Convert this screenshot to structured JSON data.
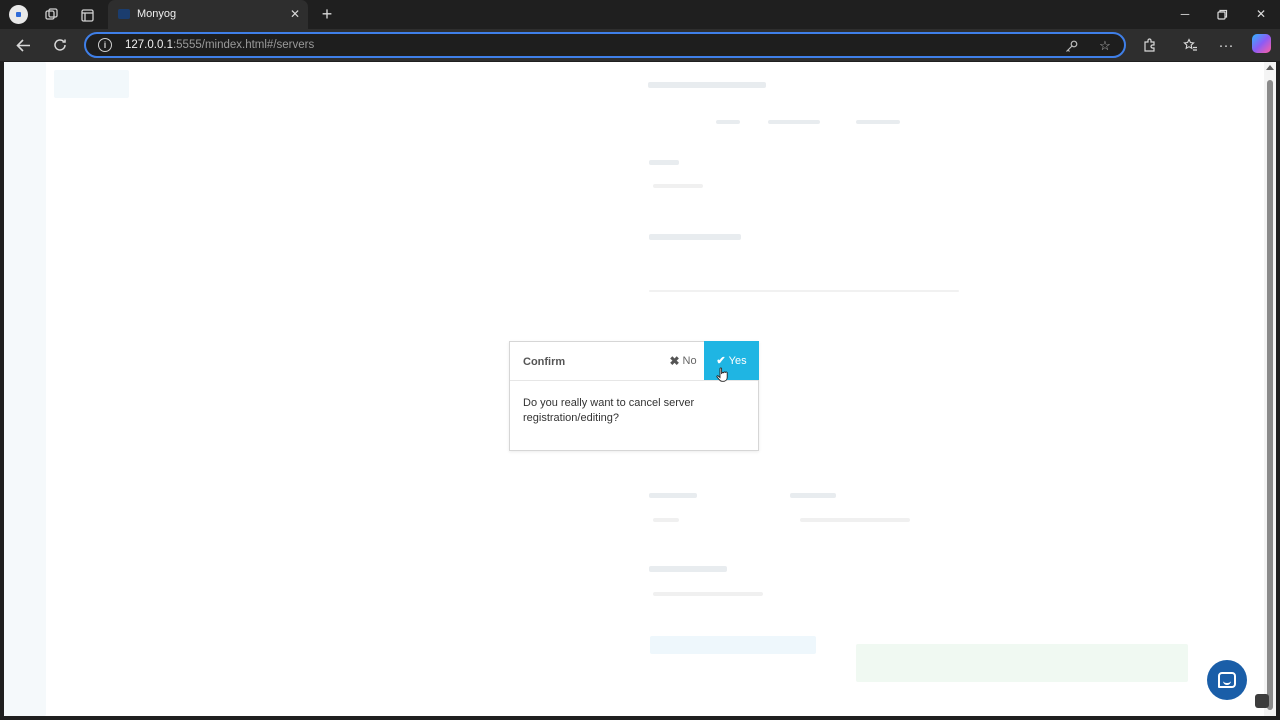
{
  "browser": {
    "tab_title": "Monyog",
    "url_host": "127.0.0.1",
    "url_rest": ":5555/mindex.html#/servers"
  },
  "dialog": {
    "title": "Confirm",
    "no_label": "No",
    "yes_label": "Yes",
    "message": "Do you really want to cancel server registration/editing?"
  },
  "colors": {
    "accent": "#1fb5e3",
    "address_focus": "#3f7fe8",
    "chat": "#1a5ea8"
  },
  "icons": {
    "no": "close-icon",
    "yes": "check-icon",
    "chat": "chat-icon"
  }
}
